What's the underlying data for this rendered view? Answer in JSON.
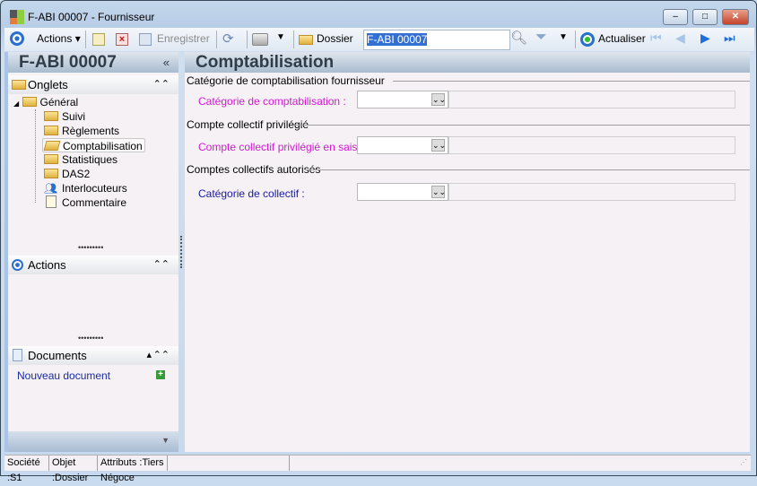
{
  "window": {
    "title": "F-ABI 00007 -  Fournisseur",
    "minimize": "‒",
    "maximize": "□",
    "close": "✕"
  },
  "toolbar": {
    "actions": "Actions",
    "save": "Enregistrer",
    "folder": "Dossier",
    "search_value": "F-ABI 00007",
    "refresh": "Actualiser"
  },
  "left": {
    "title": "F-ABI 00007",
    "collapse": "«",
    "tabs_header": "Onglets",
    "tree": {
      "root": "Général",
      "items": [
        "Suivi",
        "Règlements",
        "Comptabilisation",
        "Statistiques",
        "DAS2",
        "Interlocuteurs",
        "Commentaire"
      ]
    },
    "actions_header": "Actions",
    "documents_header": "Documents",
    "new_document": "Nouveau document"
  },
  "main": {
    "title": "Comptabilisation",
    "groups": [
      {
        "title": "Catégorie de comptabilisation fournisseur",
        "field": "Catégorie de comptabilisation :",
        "color": "#d01ad0"
      },
      {
        "title": "Compte collectif privilégié",
        "field": "Compte collectif privilégié en saisie :",
        "color": "#d01ad0"
      },
      {
        "title": "Comptes collectifs autorisés",
        "field": "Catégorie de collectif :",
        "color": "#1a1a9a"
      }
    ]
  },
  "status": {
    "company": "Société :S1",
    "object": "Objet :Dossier",
    "attributes": "Attributs :Tiers Négoce"
  }
}
